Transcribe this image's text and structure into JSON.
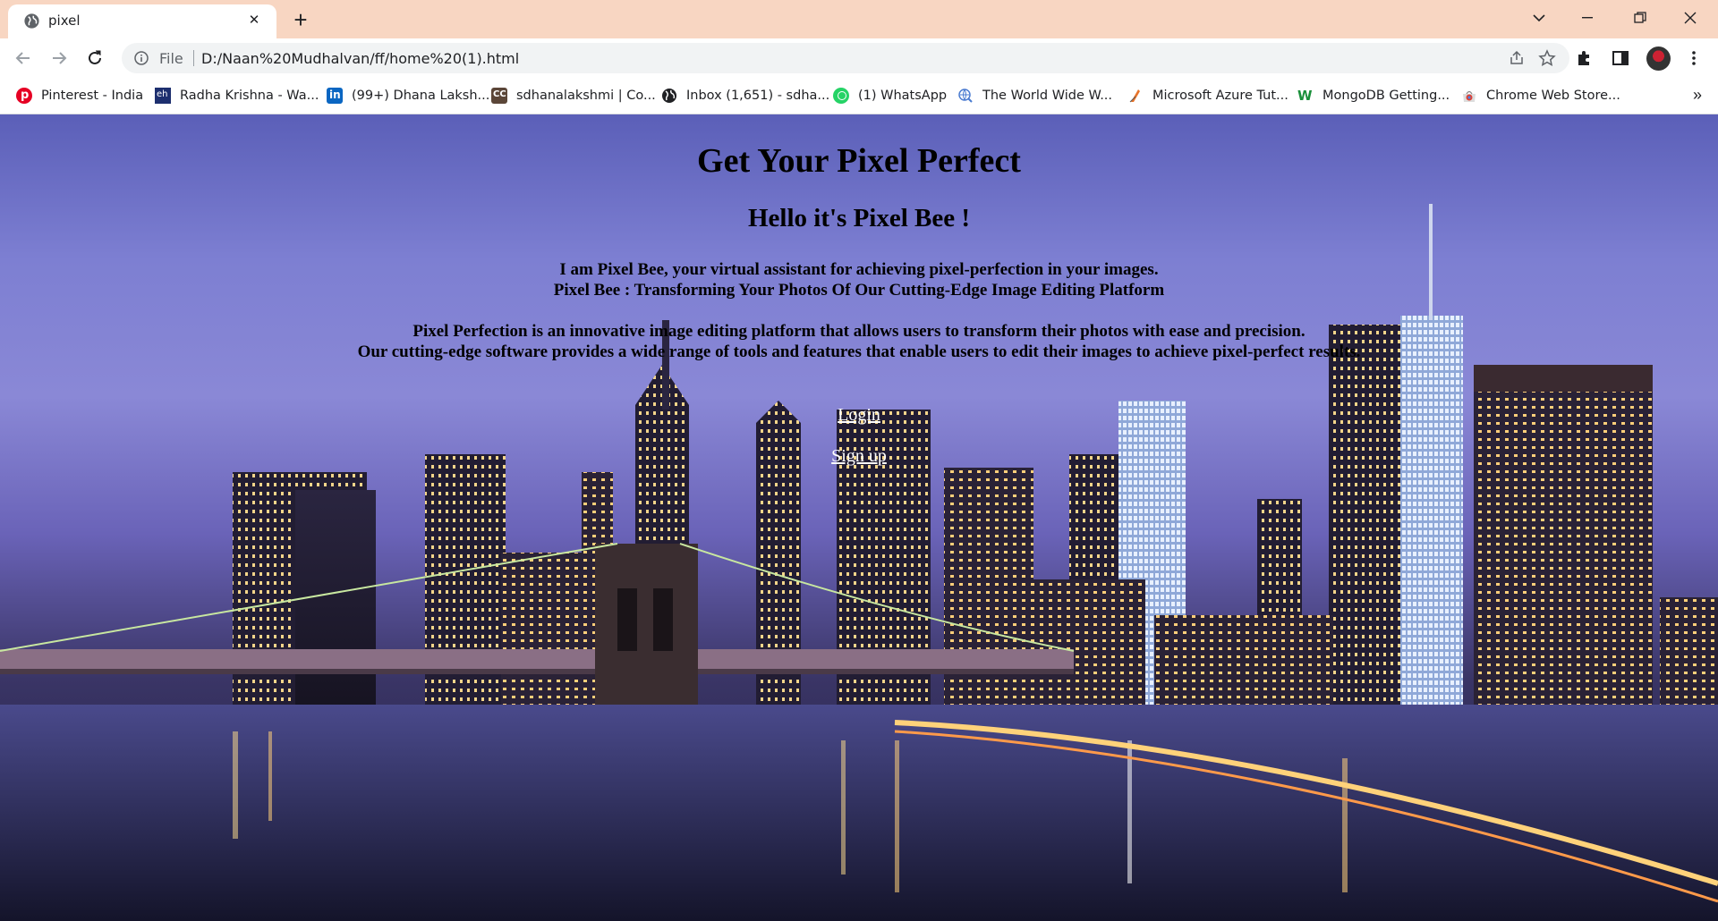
{
  "browser": {
    "tab": {
      "title": "pixel",
      "close_label": "✕"
    },
    "new_tab_label": "+",
    "omnibox": {
      "scheme": "File",
      "url": "D:/Naan%20Mudhalvan/ff/home%20(1).html"
    },
    "bookmarks": [
      {
        "label": "Pinterest - India",
        "icon": "pinterest-icon",
        "color": "#e60023"
      },
      {
        "label": "Radha Krishna - Wa...",
        "icon": "radha-krishna-icon",
        "color": "#1d2f6f"
      },
      {
        "label": "(99+) Dhana Laksh...",
        "icon": "linkedin-icon",
        "color": "#0a66c2"
      },
      {
        "label": "sdhanalakshmi | Co...",
        "icon": "codechef-icon",
        "color": "#5b4638"
      },
      {
        "label": "Inbox (1,651) - sdha...",
        "icon": "globe-icon",
        "color": "#202124"
      },
      {
        "label": "(1) WhatsApp",
        "icon": "whatsapp-icon",
        "color": "#25d366"
      },
      {
        "label": "The World Wide W...",
        "icon": "www-icon",
        "color": "#4a7bd0"
      },
      {
        "label": "Microsoft Azure Tut...",
        "icon": "azure-icon",
        "color": "#e8742a"
      },
      {
        "label": "MongoDB Getting...",
        "icon": "mongodb-icon",
        "color": "#1a8f3a"
      },
      {
        "label": "Chrome Web Store...",
        "icon": "chrome-webstore-icon",
        "color": "#db4437"
      }
    ],
    "bookmarks_more": "»"
  },
  "page": {
    "heading": "Get Your Pixel Perfect",
    "subheading": "Hello it's Pixel Bee !",
    "intro_line1": "I am Pixel Bee, your virtual assistant for achieving pixel-perfection in your images.",
    "intro_line2": "Pixel Bee : Transforming Your Photos Of Our Cutting-Edge Image Editing Platform",
    "desc_line1": "Pixel Perfection is an innovative image editing platform that allows users to transform their photos with ease and precision.",
    "desc_line2": "Our cutting-edge software provides a wide range of tools and features that enable users to edit their images to achieve pixel-perfect results.",
    "login_link": "Login",
    "signup_link": "Sign up"
  }
}
